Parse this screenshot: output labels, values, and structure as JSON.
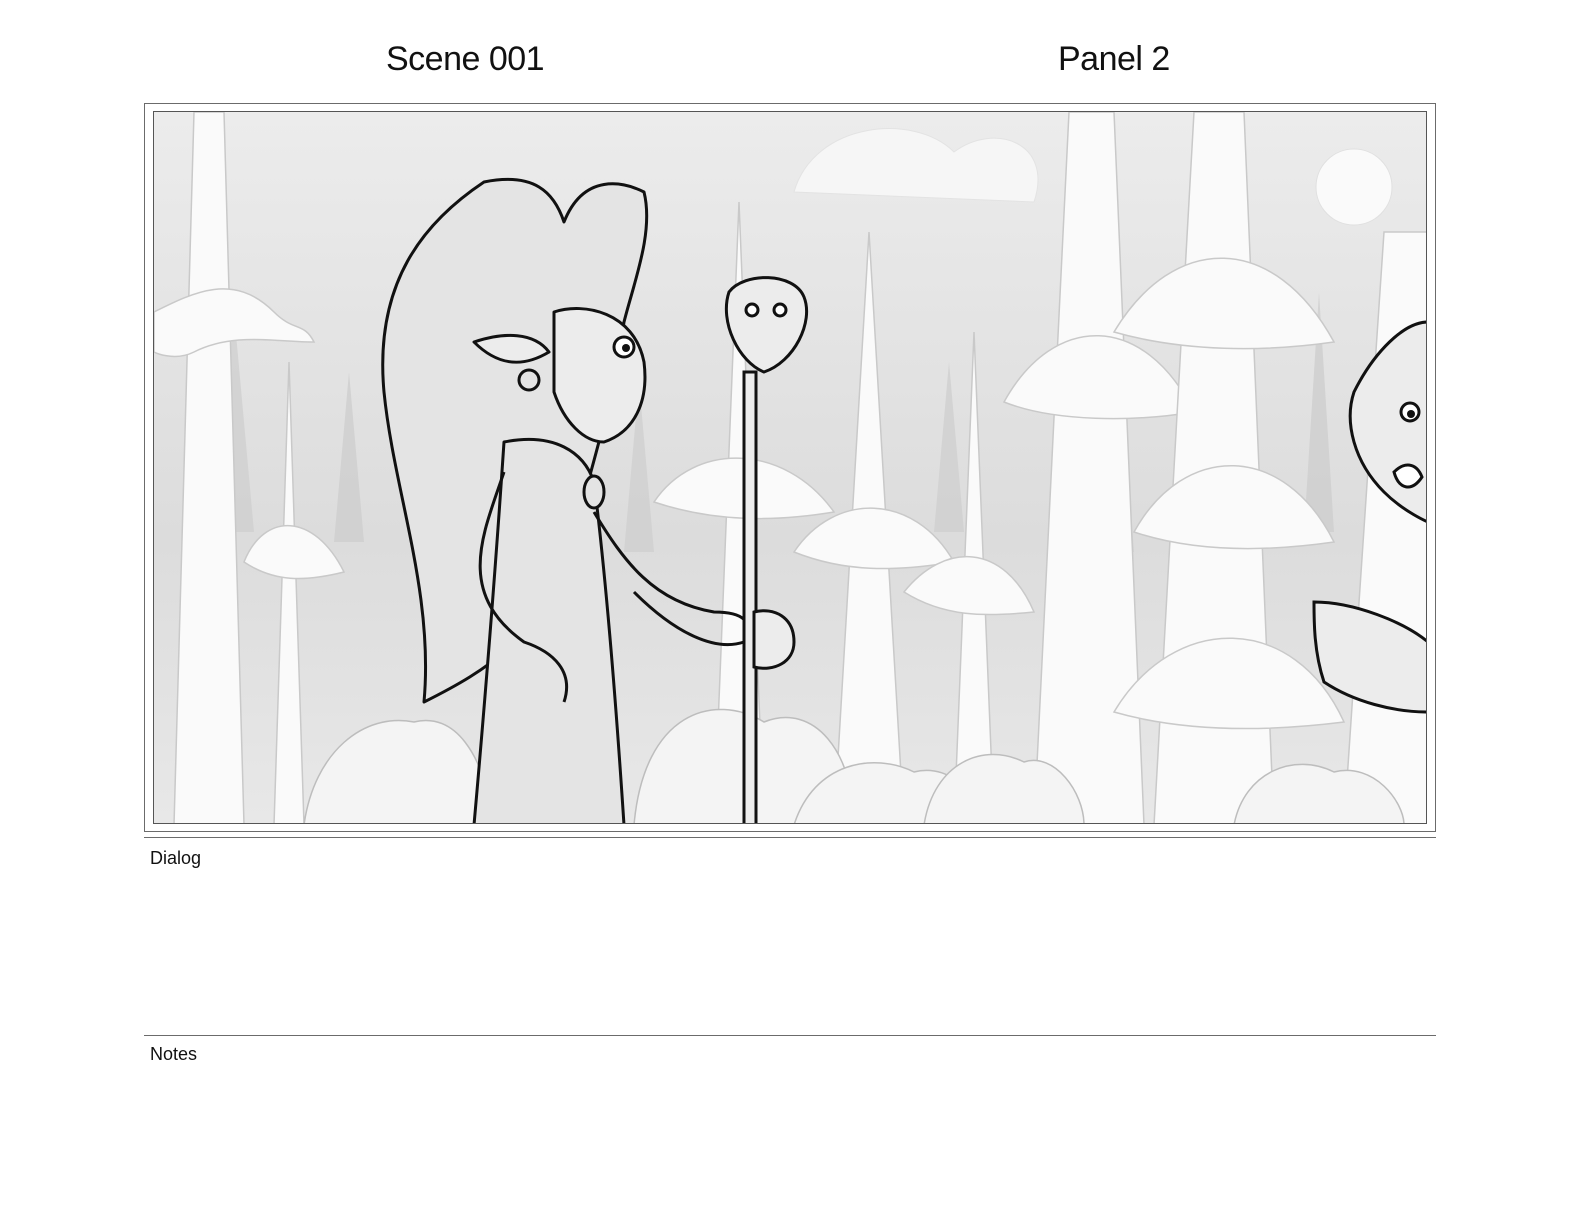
{
  "header": {
    "scene_label": "Scene 001",
    "panel_label": "Panel 2"
  },
  "dialog": {
    "label": "Dialog",
    "text": ""
  },
  "notes": {
    "label": "Notes",
    "text": ""
  },
  "artwork": {
    "subject": "forest-scene-sketch",
    "palette": {
      "background": "#f2f2f2",
      "tree_fill": "#fafafa",
      "tree_shadow": "#d6d6d6",
      "line": "#111111",
      "soft_line": "#9a9a9a"
    }
  }
}
